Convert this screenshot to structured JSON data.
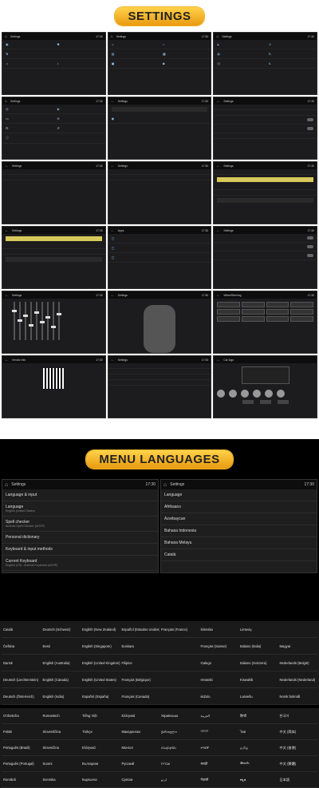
{
  "banner_settings": "SETTINGS",
  "banner_languages": "MENU LANGUAGES",
  "status": {
    "title": "Settings",
    "clock": "17:30"
  },
  "grid_titles": [
    "Settings",
    "Settings",
    "Settings",
    "Settings",
    "Settings",
    "Settings",
    "Settings",
    "Settings",
    "Settings",
    "Settings",
    "Apps",
    "Settings",
    "Settings",
    "Settings",
    "WheelSteering",
    "Vendor info",
    "Settings",
    "Car logo"
  ],
  "menu_languages": {
    "left_header": "Language & input",
    "right_header": "Language",
    "left_items": [
      {
        "t": "Language",
        "s": "English (United States)"
      },
      {
        "t": "Spell checker",
        "s": "Android Spell Checker (AOSP)"
      },
      {
        "t": "Personal dictionary",
        "s": ""
      },
      {
        "t": "Keyboard & input methods",
        "s": ""
      },
      {
        "t": "Current Keyboard",
        "s": "English (US) - Android Keyboard (AOSP)"
      }
    ],
    "right_items": [
      "Afrikaans",
      "Azərbaycan",
      "Bahasa Indonesia",
      "Bahasa Melayu",
      "Català"
    ]
  },
  "langs_a": [
    "Català",
    "Deutsch (Schweiz)",
    "English (New Zealand)",
    "Español (Estados Unidos)",
    "Français (France)",
    "Íslenska",
    "Lietuvių",
    "",
    "Čeština",
    "Eesti",
    "English (Singapore)",
    "Euskara",
    "",
    "Français (Suisse)",
    "Italiano (Italia)",
    "Magyar",
    "Dansk",
    "English (Australia)",
    "English (United Kingdom)",
    "Filipino",
    "",
    "Galego",
    "Italiano (Svizzera)",
    "Nederlands (België)",
    "Deutsch (Liechtenstein)",
    "English (Canada)",
    "English (United States)",
    "Français (Belgique)",
    "",
    "Hrvatski",
    "Kiswahili",
    "Nederlands (Nederland)",
    "Deutsch (Österreich)",
    "English (India)",
    "Español (España)",
    "Français (Canada)",
    "",
    "isiZulu",
    "Latviešu",
    "Norsk bokmål"
  ],
  "langs_b": [
    "O'zbekcha",
    "Rumantsch",
    "Tiếng Việt",
    "Ελληνικά",
    "Українська",
    "العربية",
    "हिन्दी",
    "한국어",
    "Polski",
    "Slovenščina",
    "Türkçe",
    "Македонски",
    "ქართული",
    "বাংলা",
    "ไทย",
    "中文 (简体)",
    "Português (Brasil)",
    "Slovenčina",
    "Ελληνικά",
    "Монгол",
    "Հայերեն",
    "ትግርኛ",
    "தமிழ்",
    "中文 (香港)",
    "Português (Portugal)",
    "Suomi",
    "Български",
    "Русский",
    "עברית",
    "मराठी",
    "తెలుగు",
    "中文 (繁體)",
    "Română",
    "Svenska",
    "Кыргызча",
    "Српски",
    "اردو",
    "नेपाली",
    "ಕನ್ನಡ",
    "日本語"
  ]
}
